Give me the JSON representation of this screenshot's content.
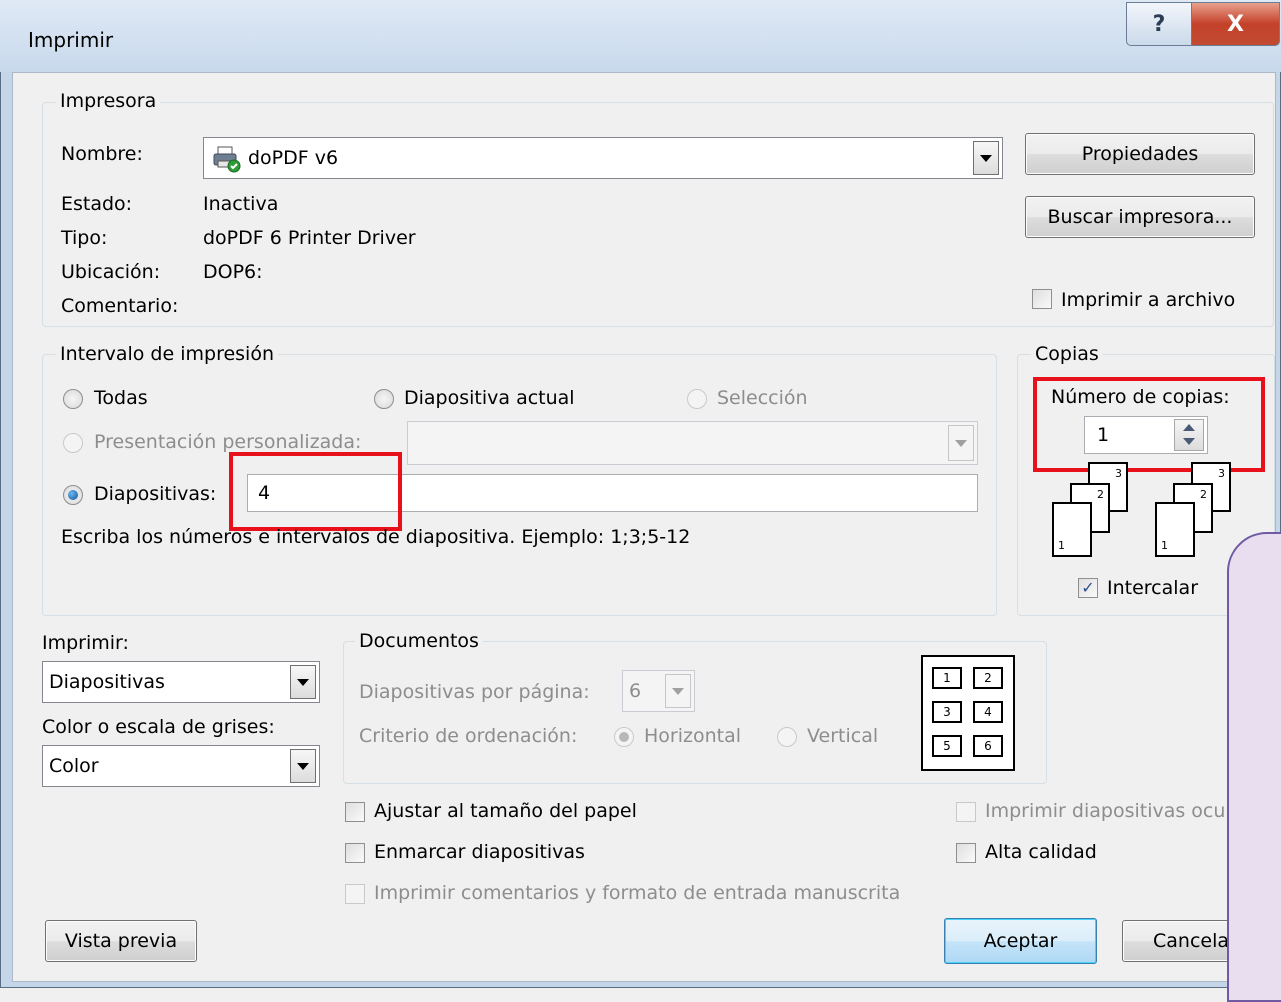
{
  "window": {
    "title": "Imprimir",
    "help_label": "?",
    "close_label": "X"
  },
  "printer": {
    "group_title": "Impresora",
    "name_label": "Nombre:",
    "name_value": "doPDF v6",
    "status_label": "Estado:",
    "status_value": "Inactiva",
    "type_label": "Tipo:",
    "type_value": "doPDF  6 Printer Driver",
    "location_label": "Ubicación:",
    "location_value": "DOP6:",
    "comment_label": "Comentario:",
    "properties_button": "Propiedades",
    "find_printer_button": "Buscar impresora...",
    "print_to_file_label": "Imprimir a archivo",
    "print_to_file_checked": false
  },
  "range": {
    "group_title": "Intervalo de impresión",
    "all_label": "Todas",
    "current_label": "Diapositiva actual",
    "selection_label": "Selección",
    "custom_label": "Presentación personalizada:",
    "slides_label": "Diapositivas:",
    "slides_value": "4",
    "selected": "slides",
    "hint": "Escriba los números e intervalos de diapositiva. Ejemplo: 1;3;5-12"
  },
  "copies": {
    "group_title": "Copias",
    "count_label": "Número de copias:",
    "count_value": "1",
    "collate_label": "Intercalar",
    "collate_checked": true,
    "stack_numbers": [
      "1",
      "2",
      "3"
    ]
  },
  "print_what": {
    "label": "Imprimir:",
    "value": "Diapositivas",
    "color_label": "Color o escala de grises:",
    "color_value": "Color"
  },
  "handouts": {
    "group_title": "Documentos",
    "per_page_label": "Diapositivas por página:",
    "per_page_value": "6",
    "order_label": "Criterio de ordenación:",
    "horizontal_label": "Horizontal",
    "vertical_label": "Vertical",
    "preview_numbers": [
      "1",
      "2",
      "3",
      "4",
      "5",
      "6"
    ]
  },
  "options": {
    "fit_paper_label": "Ajustar al tamaño del papel",
    "frame_slides_label": "Enmarcar diapositivas",
    "comments_label": "Imprimir comentarios y formato de entrada manuscrita",
    "hidden_slides_label": "Imprimir diapositivas ocu",
    "high_quality_label": "Alta calidad"
  },
  "footer": {
    "preview_button": "Vista previa",
    "ok_button": "Aceptar",
    "cancel_button": "Cancela"
  },
  "colors": {
    "highlight_red": "#e8101a",
    "title_bar": "#c8d9ec",
    "close_button": "#c4412a"
  }
}
